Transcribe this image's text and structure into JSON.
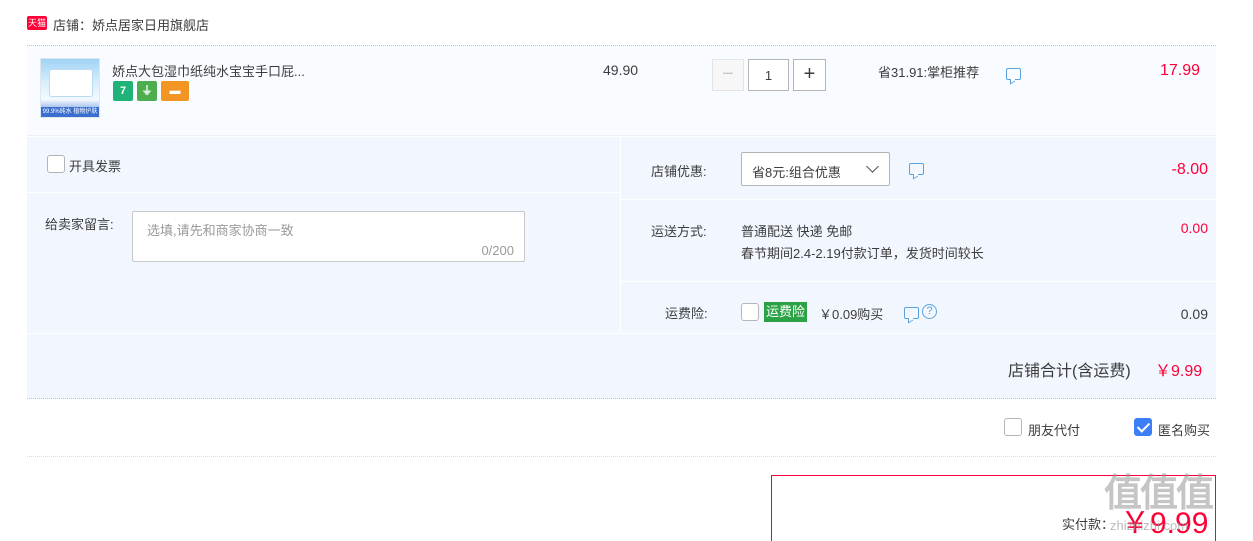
{
  "shop": {
    "badge": "天猫",
    "name": "店铺：娇点居家日用旗舰店"
  },
  "item": {
    "thumb_strip": "99.9%纯水 植物护肤",
    "title": "娇点大包湿巾纸纯水宝宝手口屁...",
    "icons": [
      "7",
      "⏚",
      "▬"
    ],
    "unit_price": "49.90",
    "qty_minus": "−",
    "quantity": "1",
    "qty_plus": "+",
    "saving": "省31.91:掌柜推荐",
    "total": "17.99"
  },
  "invoice": {
    "label": "开具发票",
    "checked": false
  },
  "memo": {
    "label": "给卖家留言:",
    "placeholder": "选填,请先和商家协商一致",
    "counter": "0/200"
  },
  "discount": {
    "label": "店铺优惠:",
    "selected": "省8元:组合优惠",
    "amount": "-8.00"
  },
  "shipping": {
    "label": "运送方式:",
    "method": "普通配送 快递 免邮",
    "note": "春节期间2.4-2.19付款订单，发货时间较长",
    "amount": "0.00"
  },
  "insurance": {
    "label": "运费险:",
    "badge": "运费险",
    "price_text": "￥0.09购买",
    "amount": "0.09",
    "checked": false
  },
  "shop_total": {
    "label": "店铺合计(含运费)",
    "amount": "￥9.99"
  },
  "options": {
    "friend_pay": "朋友代付",
    "friend_pay_checked": false,
    "anonymous": "匿名购买",
    "anonymous_checked": true
  },
  "payment": {
    "label": "实付款：",
    "amount": "￥9.99"
  },
  "watermark": {
    "logo": "值值值",
    "url": "zhizhizhi.com"
  },
  "colors": {
    "accent_red": "#ff0036",
    "panel_bg": "#f2f7ff",
    "check_blue": "#3c7ef6",
    "insurance_green": "#2ba245"
  }
}
